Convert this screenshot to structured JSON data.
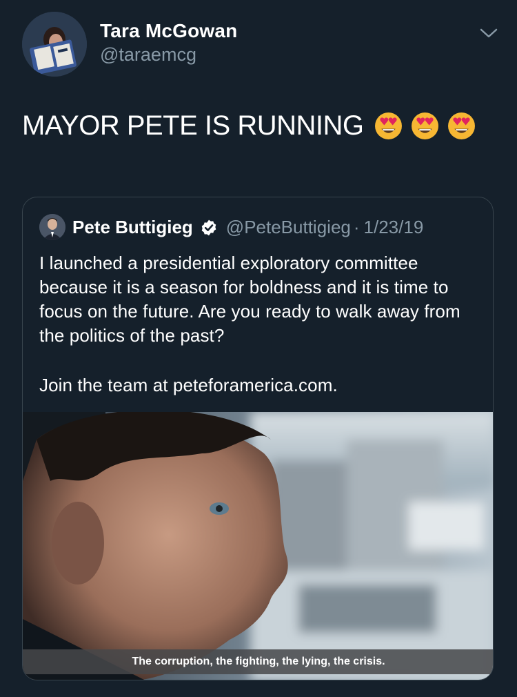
{
  "tweet": {
    "author": {
      "name": "Tara McGowan",
      "handle": "@taraemcg"
    },
    "text": "MAYOR PETE IS RUNNING",
    "emojis": [
      "heart-eyes-emoji",
      "heart-eyes-emoji",
      "heart-eyes-emoji"
    ],
    "menu_icon": "chevron-down-icon"
  },
  "quoted_tweet": {
    "author": {
      "name": "Pete Buttigieg",
      "handle": "@PeteButtigieg",
      "verified": true
    },
    "separator": "·",
    "date": "1/23/19",
    "paragraphs": [
      "I launched a presidential exploratory committee because it is a season for boldness and it is time to focus on the future. Are you ready to walk away from the politics of the past?",
      "Join the team at peteforamerica.com."
    ],
    "media": {
      "caption": "The corruption, the fighting, the lying, the crisis."
    }
  },
  "colors": {
    "background": "#15202b",
    "secondary_text": "#8899a6",
    "border": "#38444d",
    "verified_badge": "#ffffff"
  }
}
